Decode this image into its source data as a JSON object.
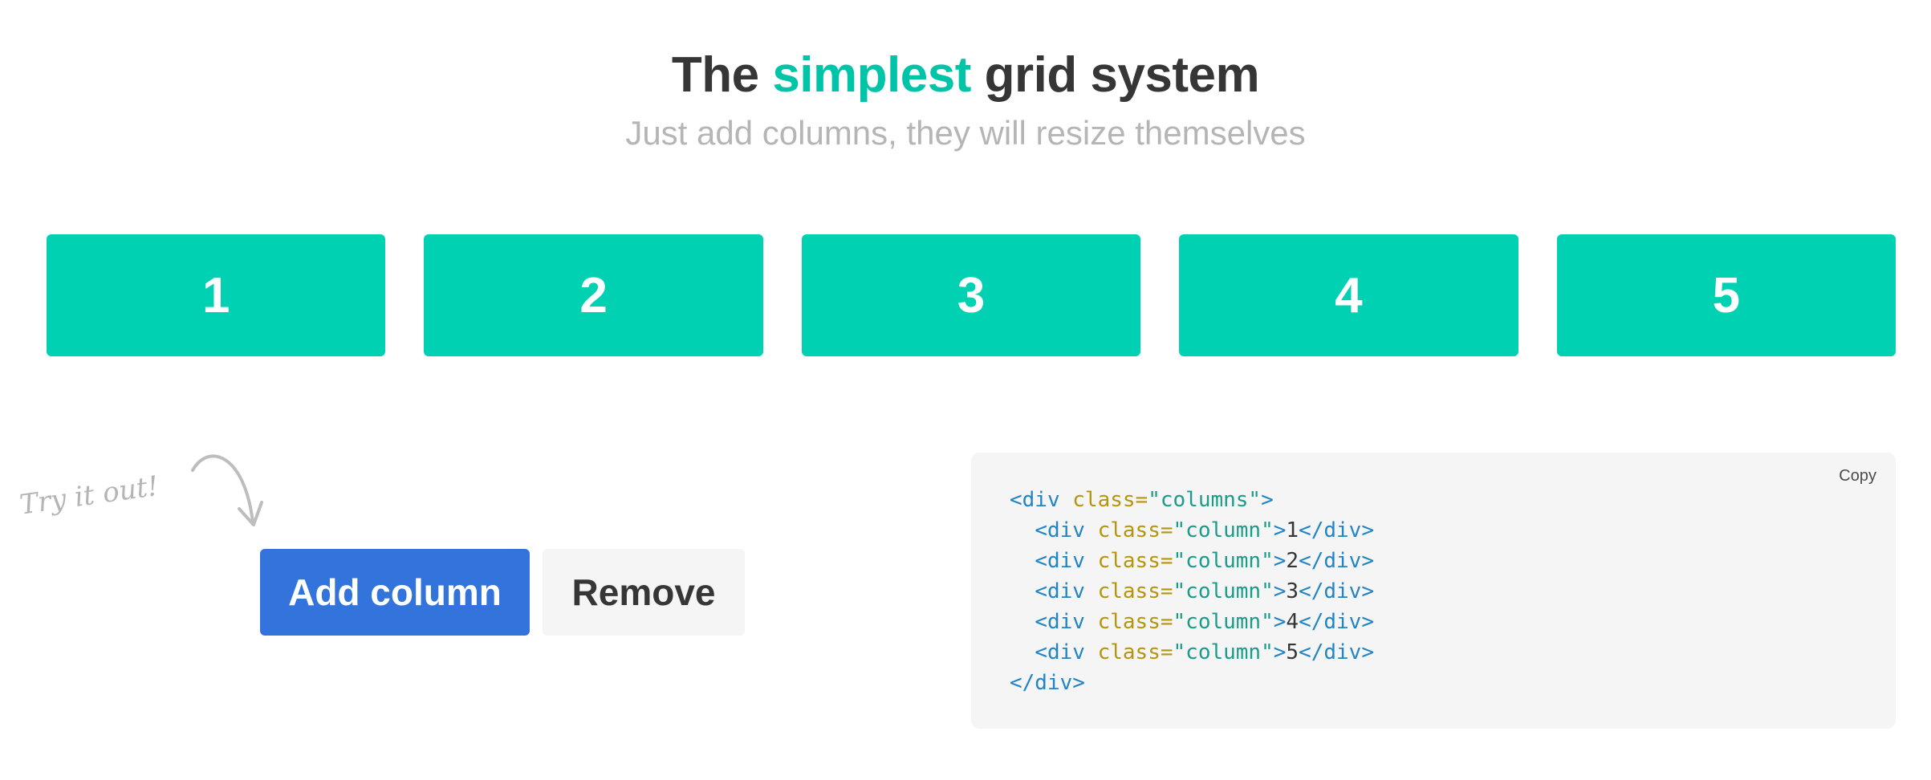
{
  "hero": {
    "title_before": "The",
    "title_accent": "simplest",
    "title_after": "grid system",
    "subtitle": "Just add columns, they will resize themselves"
  },
  "columns": [
    {
      "label": "1"
    },
    {
      "label": "2"
    },
    {
      "label": "3"
    },
    {
      "label": "4"
    },
    {
      "label": "5"
    }
  ],
  "annotation": {
    "text": "Try it out!"
  },
  "actions": {
    "add_label": "Add column",
    "remove_label": "Remove"
  },
  "code": {
    "copy_label": "Copy",
    "outer_open": "<div",
    "outer_attr": "class=",
    "outer_value": "\"columns\"",
    "outer_close_bracket": ">",
    "inner_open": "<div",
    "inner_attr": "class=",
    "inner_value": "\"column\"",
    "inner_close_bracket": ">",
    "inner_end": "</div>",
    "outer_end": "</div>",
    "lines": [
      "1",
      "2",
      "3",
      "4",
      "5"
    ]
  },
  "colors": {
    "accent": "#00c4a7",
    "column_bg": "#00d1b2",
    "primary_button": "#3273dc",
    "code_bg": "#f5f5f5"
  },
  "icons": {
    "arrow": "curved-arrow-icon"
  }
}
